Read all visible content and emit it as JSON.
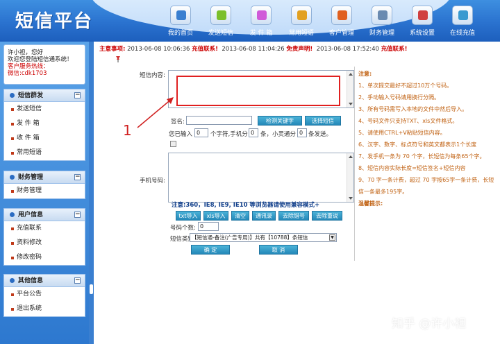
{
  "app": {
    "title": "短信平台"
  },
  "nav": [
    {
      "label": "我的首页",
      "icon": "home-icon",
      "color": "#3a7fd0"
    },
    {
      "label": "发送短信",
      "icon": "send-sms-icon",
      "color": "#7cbf2a"
    },
    {
      "label": "发 件 箱",
      "icon": "outbox-icon",
      "color": "#d05ad8"
    },
    {
      "label": "常用短语",
      "icon": "phrases-icon",
      "color": "#e2a020"
    },
    {
      "label": "客户管理",
      "icon": "customers-icon",
      "color": "#e06020"
    },
    {
      "label": "财务管理",
      "icon": "finance-icon",
      "color": "#6a8ab0"
    },
    {
      "label": "系统设置",
      "icon": "settings-icon",
      "color": "#d04040"
    },
    {
      "label": "在线充值",
      "icon": "recharge-icon",
      "color": "#3a9ad0"
    }
  ],
  "welcome": {
    "line1": "许小袒，您好",
    "line2": "欢迎您登陆短信通系统！",
    "line3": "客户服务热线：",
    "line4": "微信:cdk1703"
  },
  "sidebar": {
    "groups": [
      {
        "title": "短信群发",
        "items": [
          "发送短信",
          "发 件 箱",
          "收 件 箱",
          "常用短语"
        ]
      },
      {
        "title": "财务管理",
        "items": [
          "财务管理"
        ]
      },
      {
        "title": "用户信息",
        "items": [
          "充值联系",
          "资料修改",
          "修改密码"
        ]
      },
      {
        "title": "其他信息",
        "items": [
          "平台公告",
          "退出系统"
        ]
      }
    ]
  },
  "notice": {
    "label": "主意事项:",
    "items": [
      {
        "date": "2013-06-08 10:06:36",
        "msg": "充值联系!"
      },
      {
        "date": "2013-06-08 11:04:26",
        "msg": "免责声明!"
      },
      {
        "date": "2013-06-08 17:52:40",
        "msg": "充值联系!"
      }
    ]
  },
  "form": {
    "content_label": "短信内容:",
    "sign_label": "签名:",
    "sign_value": "",
    "detect_btn": "检测关键字",
    "select_sign_btn": "选择短信",
    "count_prefix": "您已输入",
    "count_value": "0",
    "count_mid": "个字符,手机分",
    "parts_value": "0",
    "parts_mid": "条，小灵通分",
    "phs_value": "0",
    "parts_suffix": "条发送。",
    "phone_label": "手机号码:",
    "browser_note": "注意:360，IE8, IE9, IE10 等浏览器请使用兼容模式+",
    "actions": [
      "txt导入",
      "xls导入",
      "清空",
      "通讯录",
      "去除错号",
      "去除重说"
    ],
    "phone_count_label": "号码个数:",
    "phone_count_value": "0",
    "category_label": "短信类别",
    "category_value": "【短信通-备注(广告专用)】共有【10788】条短信",
    "ok_btn": "确 定",
    "cancel_btn": "取 消"
  },
  "notes": {
    "title": "注意:",
    "items": [
      "1、单次提交最好不超过10万个号码。",
      "2、手动输入号码请用换行分隔。",
      "3、所有号码需写入本地的文件中然后导入。",
      "4、号码文件只支持TXT、xls文件格式。",
      "5、请使用CTRL+V粘贴短信内容。",
      "6、汉字、数字、标点符号和英文都表示1个长度",
      "7、发手机一条为 70 个字，长短信为每条65个字。",
      "8、短信内容实际长度=短信签名+短信内容",
      "9、70 字一条计费，超过 70 字按65字一条计费，长短信一条最多195字。"
    ],
    "footer": "温馨提示:"
  },
  "annotation": {
    "number": "1"
  },
  "watermark": "知乎 @许小袒"
}
